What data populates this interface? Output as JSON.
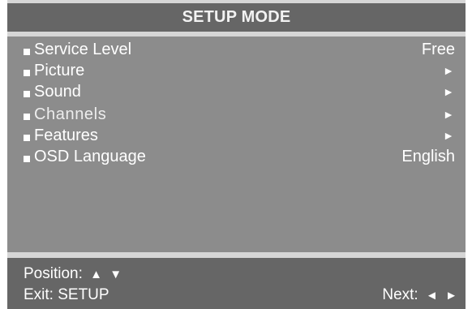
{
  "header": {
    "title": "SETUP MODE"
  },
  "menu": {
    "items": [
      {
        "label": "Service Level",
        "value": "Free"
      },
      {
        "label": "Picture",
        "value": "►"
      },
      {
        "label": "Sound",
        "value": "►"
      },
      {
        "label": "Channels",
        "value": "►"
      },
      {
        "label": "Features",
        "value": "►"
      },
      {
        "label": "OSD Language",
        "value": "English"
      }
    ]
  },
  "footer": {
    "position_label": "Position:",
    "position_up": "▲",
    "position_down": "▼",
    "exit_label": "Exit: SETUP",
    "next_label": "Next:",
    "next_left": "◄",
    "next_right": "►"
  }
}
